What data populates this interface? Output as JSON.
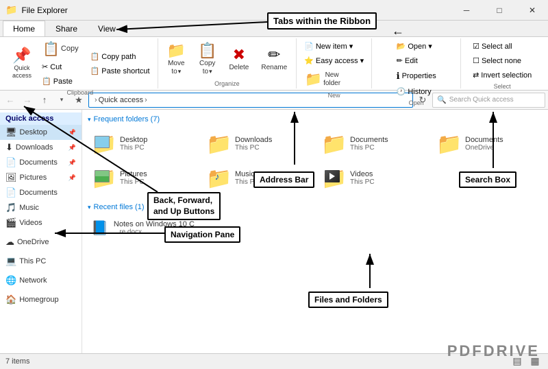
{
  "titleBar": {
    "icon": "📁",
    "title": "File Explorer",
    "minBtn": "─",
    "maxBtn": "□",
    "closeBtn": "✕"
  },
  "ribbonTabs": {
    "tabs": [
      "Home",
      "Share",
      "View"
    ],
    "activeTab": "Home",
    "arrowLabel": "←",
    "annotationLabel": "Tabs within the Ribbon"
  },
  "ribbon": {
    "groups": {
      "clipboard": {
        "label": "Clipboard",
        "quickAccessLabel": "Quick\naccess",
        "cutLabel": "Cut",
        "copyLabel": "Copy",
        "pasteLabel": "Paste",
        "copyPathLabel": "Copy path",
        "pasteShortcutLabel": "Paste shortcut"
      },
      "organize": {
        "label": "Organize",
        "moveToLabel": "Move\nto",
        "copyToLabel": "Copy\nto",
        "deleteLabel": "Delete",
        "renameLabel": "Rename"
      },
      "new": {
        "label": "New",
        "newItemLabel": "New item ▾",
        "easyAccessLabel": "Easy access ▾",
        "newFolderLabel": "New\nfolder"
      },
      "open": {
        "label": "Open",
        "openLabel": "Open ▾",
        "editLabel": "Edit",
        "historyLabel": "History",
        "propertiesLabel": "Properties"
      },
      "select": {
        "label": "Select",
        "selectAllLabel": "Select all",
        "selectNoneLabel": "Select none",
        "invertSelLabel": "Invert selection"
      }
    }
  },
  "addressBar": {
    "backBtn": "←",
    "forwardBtn": "→",
    "upBtn": "↑",
    "recentBtn": "▾",
    "starBtn": "★",
    "path": "Quick access",
    "refreshBtn": "↻",
    "searchPlaceholder": "Search Quick access"
  },
  "navPane": {
    "quickAccessLabel": "Quick access",
    "items": [
      {
        "name": "Desktop",
        "icon": "🖥",
        "pinned": true
      },
      {
        "name": "Downloads",
        "icon": "⬇",
        "pinned": true
      },
      {
        "name": "Documents",
        "icon": "📄",
        "pinned": true
      },
      {
        "name": "Pictures",
        "icon": "🖼",
        "pinned": true
      },
      {
        "name": "Documents",
        "icon": "📄",
        "pinned": false
      },
      {
        "name": "Music",
        "icon": "🎵",
        "pinned": false
      },
      {
        "name": "Videos",
        "icon": "🎬",
        "pinned": false
      },
      {
        "name": "",
        "icon": "",
        "pinned": false
      },
      {
        "name": "OneDrive",
        "icon": "☁",
        "pinned": false
      },
      {
        "name": "",
        "icon": "",
        "pinned": false
      },
      {
        "name": "This PC",
        "icon": "💻",
        "pinned": false
      },
      {
        "name": "",
        "icon": "",
        "pinned": false
      },
      {
        "name": "Network",
        "icon": "🌐",
        "pinned": false
      },
      {
        "name": "",
        "icon": "",
        "pinned": false
      },
      {
        "name": "Homegroup",
        "icon": "🏠",
        "pinned": false
      }
    ]
  },
  "content": {
    "frequentHeader": "Frequent folders (7)",
    "recentHeader": "Recent files (1)",
    "folders": [
      {
        "name": "Desktop",
        "path": "This PC",
        "hasThumb": false
      },
      {
        "name": "Downloads",
        "path": "This PC",
        "hasThumb": false
      },
      {
        "name": "Documents",
        "path": "This PC",
        "hasThumb": false
      },
      {
        "name": "Documents",
        "path": "OneDrive",
        "hasThumb": false
      },
      {
        "name": "Pictures",
        "path": "This PC",
        "hasThumb": true
      },
      {
        "name": "Music",
        "path": "This PC",
        "hasThumb": false
      },
      {
        "name": "Videos",
        "path": "This PC",
        "hasThumb": true
      }
    ],
    "recentFiles": [
      {
        "name": "Notes on Windows 10 C",
        "path": "...re.docx",
        "icon": "📘"
      }
    ]
  },
  "annotations": {
    "tabsRibbon": "Tabs within the Ribbon",
    "backForwardUp": "Back, Forward,\nand Up Buttons",
    "addressBar": "Address Bar",
    "searchBox": "Search Box",
    "navPane": "Navigation Pane",
    "filesAndFolders": "Files and Folders"
  },
  "statusBar": {
    "itemCount": "7 items",
    "viewIcons": [
      "▤",
      "▦"
    ]
  },
  "watermark": "PDFDRIVE"
}
